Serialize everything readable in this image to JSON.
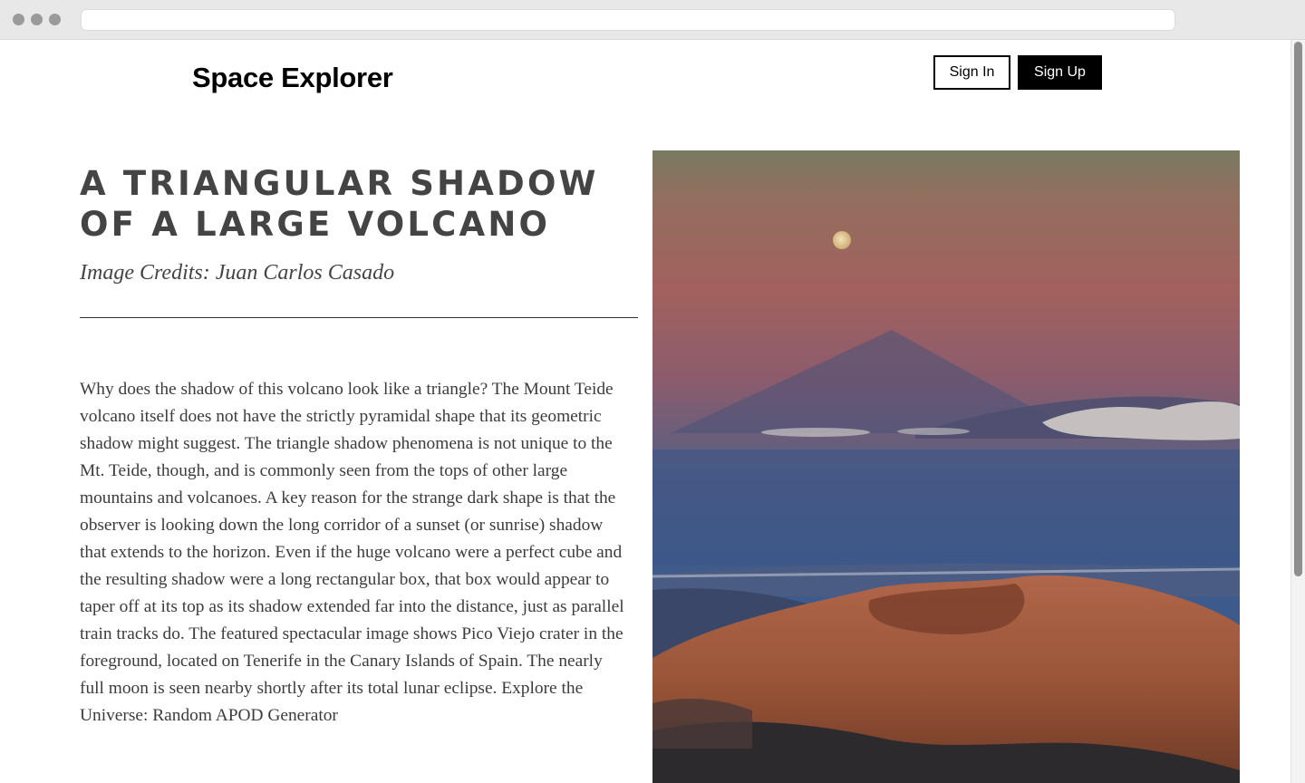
{
  "header": {
    "brand": "Space Explorer",
    "sign_in_label": "Sign In",
    "sign_up_label": "Sign Up"
  },
  "article": {
    "title": "A Triangular Shadow of a Large Volcano",
    "credits": "Image Credits: Juan Carlos Casado",
    "body": "Why does the shadow of this volcano look like a triangle? The Mount Teide volcano itself does not have the strictly pyramidal shape that its geometric shadow might suggest. The triangle shadow phenomena is not unique to the Mt. Teide, though, and is commonly seen from the tops of other large mountains and volcanoes. A key reason for the strange dark shape is that the observer is looking down the long corridor of a sunset (or sunrise) shadow that extends to the horizon. Even if the huge volcano were a perfect cube and the resulting shadow were a long rectangular box, that box would appear to taper off at its top as its shadow extended far into the distance, just as parallel train tracks do. The featured spectacular image shows Pico Viejo crater in the foreground, located on Tenerife in the Canary Islands of Spain. The nearly full moon is seen nearby shortly after its total lunar eclipse. Explore the Universe: Random APOD Generator"
  },
  "colors": {
    "title": "#444444",
    "button_primary_bg": "#000000",
    "button_primary_text": "#ffffff"
  }
}
